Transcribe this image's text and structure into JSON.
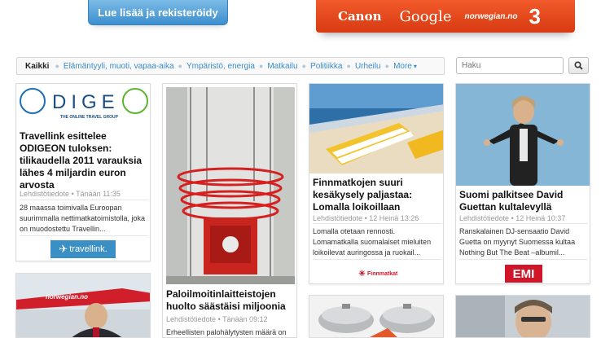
{
  "top": {
    "cta_label": "Lue lisää ja rekisteröidy",
    "sponsors": {
      "canon": "Canon",
      "google": "Google",
      "norwegian": "norwegian.no",
      "three": "3"
    }
  },
  "nav": {
    "items": [
      "Kaikki",
      "Elämäntyyli, muoti, vapaa-aika",
      "Ympäristö, energia",
      "Matkailu",
      "Politiikka",
      "Urheilu",
      "More"
    ],
    "caret": "▾"
  },
  "search": {
    "placeholder": "Haku"
  },
  "cards": [
    {
      "logo_text": "DIGE",
      "logo_tag": "THE ONLINE TRAVEL GROUP",
      "title": "Travellink esittelee ODIGEON tuloksen: tilikaudella 2011 varauksia lähes 4 miljardin euron arvosta",
      "source": "Lehdistötiedote",
      "time": "Tänään 11:35",
      "snippet": "28 maassa toimivalla Euroopan suurimmalla nettimatkatoimistolla, joka on muodostettu Travellin...",
      "badge": "travellink."
    },
    {
      "title": "Paloilmoitinlaitteistojen huolto säästäisi miljoonia",
      "source": "Lehdistötiedote",
      "time": "Tänään 09:12",
      "snippet": "Erheellisten palohälytysten määrä on"
    },
    {
      "title": "Finnmatkojen suuri kesäkysely paljastaa: Lomalla loikoillaan",
      "source": "Lehdistötiedote",
      "time": "12 Heinä 13:26",
      "snippet": "Lomalla otetaan rennosti. Lomamatkalla suomalaiset mieluiten loikoilevat auringossa ja ruokail...",
      "badge": "Finnmatkat"
    },
    {
      "title": "Suomi palkitsee David Guettan kultalevyllä",
      "source": "Lehdistötiedote",
      "time": "12 Heinä 10:37",
      "snippet": "Ranskalainen DJ-sensaatio David Guetta on myynyt Suomessa kultaa Nothing But The Beat –albumil...",
      "badge": "EMI"
    }
  ],
  "bottom": {
    "plane_text": "norwegian.no"
  }
}
